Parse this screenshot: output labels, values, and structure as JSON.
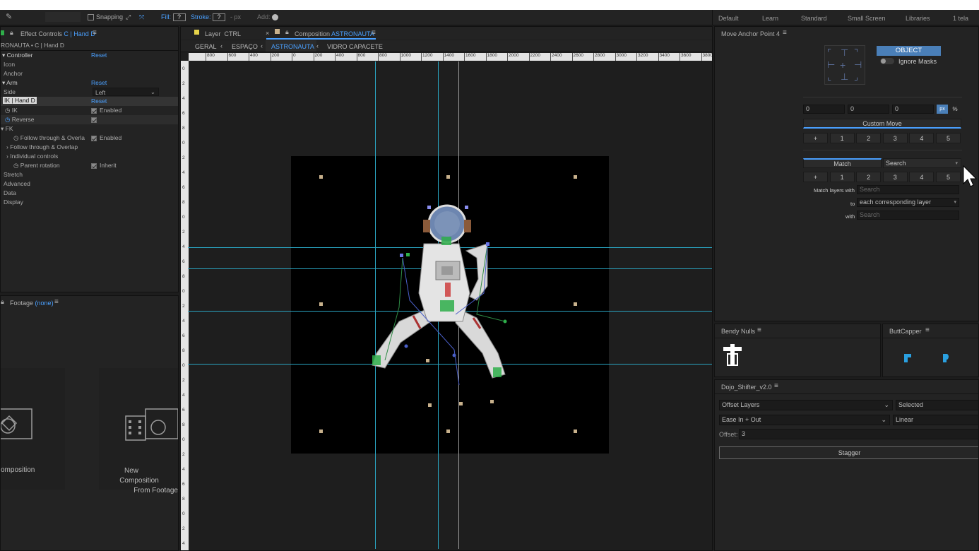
{
  "toolbar": {
    "snapping_label": "Snapping",
    "fill_label": "Fill:",
    "fill_value": "?",
    "stroke_label": "Stroke:",
    "stroke_value": "?",
    "px_label": "- px",
    "add_label": "Add:",
    "workspaces": [
      "Default",
      "Learn",
      "Standard",
      "Small Screen",
      "Libraries",
      "1 tela"
    ]
  },
  "effect_controls": {
    "tab_title": "Effect Controls",
    "tab_layer": "C | Hand D",
    "subtitle": "RONAUTA • C | Hand D",
    "rows": [
      {
        "label": "Controller",
        "value": "Reset"
      },
      {
        "label": "Icon",
        "value": ""
      },
      {
        "label": "Anchor",
        "value": ""
      },
      {
        "label": "Arm",
        "value": "Reset"
      },
      {
        "label": "Side",
        "value": "Left"
      },
      {
        "label": "IK | Hand D",
        "value": "Reset"
      },
      {
        "label": "IK",
        "value": "Enabled"
      },
      {
        "label": "Reverse",
        "value": ""
      },
      {
        "label": "FK",
        "value": ""
      },
      {
        "label": "Follow through & Overla",
        "value": "Enabled"
      },
      {
        "label": "Follow through & Overlap",
        "value": ""
      },
      {
        "label": "Individual controls",
        "value": ""
      },
      {
        "label": "Parent rotation",
        "value": "Inherit"
      },
      {
        "label": "Stretch",
        "value": ""
      },
      {
        "label": "Advanced",
        "value": ""
      },
      {
        "label": "Data",
        "value": ""
      },
      {
        "label": "Display",
        "value": ""
      }
    ]
  },
  "footage": {
    "title": "Footage",
    "value": "(none)",
    "card1_label": "omposition",
    "card2_label_line1": "New",
    "card2_label_line2": "Composition",
    "card2_label_line3": "From Footage"
  },
  "viewer": {
    "layer_tab_label": "Layer",
    "layer_tab_name": "CTRL",
    "comp_tab_label": "Composition",
    "comp_tab_name": "ASTRONAUTA",
    "breadcrumbs": [
      "GERAL",
      "ESPAÇO",
      "ASTRONAUTA",
      "VIDRO CAPACETE"
    ],
    "ruler_ticks": [
      "800",
      "600",
      "400",
      "200",
      "0",
      "200",
      "400",
      "600",
      "800",
      "1000",
      "1200",
      "1400",
      "1600",
      "1800",
      "2000",
      "2200",
      "2400",
      "2600",
      "2800",
      "3000",
      "3200",
      "3400",
      "3600",
      "3800"
    ],
    "vruler_ticks": [
      "0",
      "2",
      "4",
      "6",
      "8",
      "0",
      "2",
      "4",
      "6",
      "8",
      "0",
      "2",
      "4",
      "6",
      "8",
      "0",
      "2",
      "4",
      "6",
      "8",
      "0",
      "2",
      "4",
      "6",
      "8",
      "0",
      "2",
      "4",
      "6",
      "8",
      "0",
      "2",
      "4"
    ]
  },
  "move_anchor": {
    "title": "Move Anchor Point 4",
    "object_button": "OBJECT",
    "ignore_masks": "Ignore Masks",
    "x_value": "0",
    "y_value": "0",
    "z_value": "0",
    "unit_px": "px",
    "unit_pct": "%",
    "custom_move": "Custom Move",
    "preset_buttons": [
      "+",
      "1",
      "2",
      "3",
      "4",
      "5"
    ],
    "match_tab": "Match",
    "search_tab": "Search",
    "match_buttons": [
      "+",
      "1",
      "2",
      "3",
      "4",
      "5"
    ],
    "match_layers_label": "Match layers with",
    "match_layers_placeholder": "Search",
    "to_label": "to",
    "to_value": "each corresponding layer",
    "with_label": "with",
    "with_placeholder": "Search"
  },
  "bendy_nulls": {
    "title": "Bendy Nulls"
  },
  "buttcapper": {
    "title": "ButtCapper"
  },
  "dojo": {
    "title": "Dojo_Shifter_v2.0",
    "mode": "Offset Layers",
    "target": "Selected",
    "ease": "Ease In + Out",
    "interp": "Linear",
    "offset_label": "Offset:",
    "offset_value": "3",
    "stagger": "Stagger"
  }
}
